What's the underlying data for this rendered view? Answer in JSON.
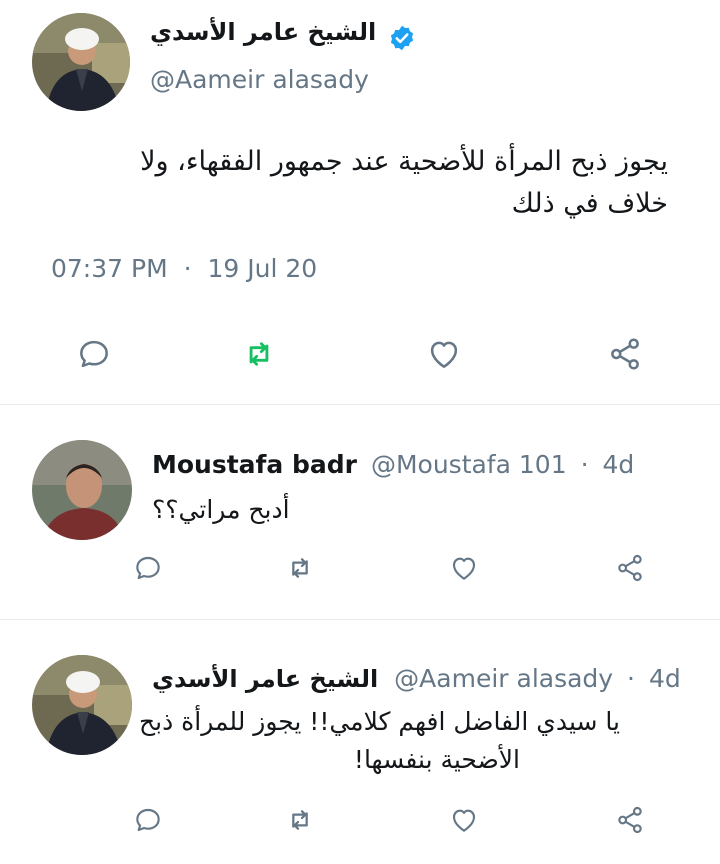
{
  "main_tweet": {
    "name": "الشيخ عامر الأسدي",
    "handle": "@Aameir alasady",
    "text_line1": "يجوز ذبح المرأة للأضحية عند جمهور الفقهاء، ولا",
    "text_line2": "خلاف في ذلك",
    "time": "07:37 PM",
    "sep": "·",
    "date": "19 Jul 20",
    "verified": true
  },
  "replies": [
    {
      "name": "Moustafa badr",
      "handle": "@Moustafa 101",
      "sep": "·",
      "age": "4d",
      "text": "أدبح مراتي؟؟"
    },
    {
      "name": "الشيخ عامر الأسدي",
      "handle": "@Aameir alasady",
      "sep": "·",
      "age": "4d",
      "text_line1": "يا سيدي الفاضل افهم كلامي!! يجوز للمرأة ذبح",
      "text_line2": "الأضحية بنفسها!"
    }
  ],
  "icons": [
    "reply-icon",
    "retweet-icon",
    "like-icon",
    "share-icon",
    "verified-badge-icon"
  ],
  "colors": {
    "verified": "#1da1f2",
    "main_retweet": "#17bf63",
    "icon_gray": "#657786",
    "divider": "#e6ecf0"
  }
}
